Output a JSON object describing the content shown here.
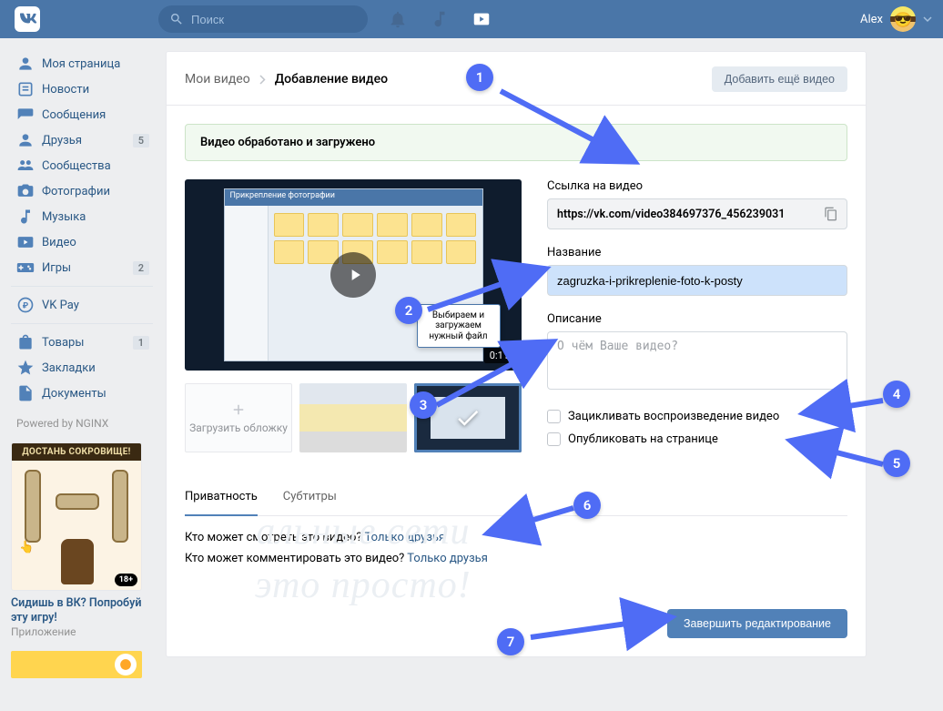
{
  "topbar": {
    "search_placeholder": "Поиск",
    "username": "Alex"
  },
  "sidebar": {
    "items": [
      {
        "icon": "profile",
        "label": "Моя страница",
        "badge": ""
      },
      {
        "icon": "news",
        "label": "Новости",
        "badge": ""
      },
      {
        "icon": "messages",
        "label": "Сообщения",
        "badge": ""
      },
      {
        "icon": "friends",
        "label": "Друзья",
        "badge": "5"
      },
      {
        "icon": "groups",
        "label": "Сообщества",
        "badge": ""
      },
      {
        "icon": "photos",
        "label": "Фотографии",
        "badge": ""
      },
      {
        "icon": "music",
        "label": "Музыка",
        "badge": ""
      },
      {
        "icon": "video",
        "label": "Видео",
        "badge": ""
      },
      {
        "icon": "games",
        "label": "Игры",
        "badge": "2"
      }
    ],
    "items2": [
      {
        "icon": "pay",
        "label": "VK Pay",
        "badge": ""
      }
    ],
    "items3": [
      {
        "icon": "market",
        "label": "Товары",
        "badge": "1"
      },
      {
        "icon": "bookmarks",
        "label": "Закладки",
        "badge": ""
      },
      {
        "icon": "docs",
        "label": "Документы",
        "badge": ""
      }
    ],
    "powered": "Powered by NGINX",
    "promo": {
      "header": "ДОСТАНЬ СОКРОВИЩЕ!",
      "title": "Сидишь в ВК? Попробуй эту игру!",
      "subtitle": "Приложение",
      "age": "18+"
    }
  },
  "panel": {
    "breadcrumb_root": "Мои видео",
    "breadcrumb_current": "Добавление видео",
    "add_more": "Добавить ещё видео",
    "success": "Видео обработано и загружено",
    "upload_cover": "Загрузить обложку",
    "video": {
      "duration": "0:11",
      "tooltip_line1": "Выбираем и",
      "tooltip_line2": "загружаем",
      "tooltip_line3": "нужный файл"
    },
    "form": {
      "link_label": "Ссылка на видео",
      "link_value": "https://vk.com/video384697376_456239031",
      "title_label": "Название",
      "title_value": "zagruzka-i-prikreplenie-foto-k-posty",
      "desc_label": "Описание",
      "desc_placeholder": "О чём Ваше видео?",
      "loop_label": "Зацикливать воспроизведение видео",
      "publish_label": "Опубликовать на странице"
    },
    "tabs": {
      "privacy": "Приватность",
      "subtitles": "Субтитры"
    },
    "privacy": {
      "view_q": "Кто может смотреть это видео? ",
      "view_v": "Только друзья",
      "comment_q": "Кто может комментировать это видео? ",
      "comment_v": "Только друзья"
    },
    "finish": "Завершить редактирование"
  },
  "watermark": {
    "line1": "альные сети",
    "line2": "это просто!"
  },
  "annotations": [
    "1",
    "2",
    "3",
    "4",
    "5",
    "6",
    "7"
  ]
}
